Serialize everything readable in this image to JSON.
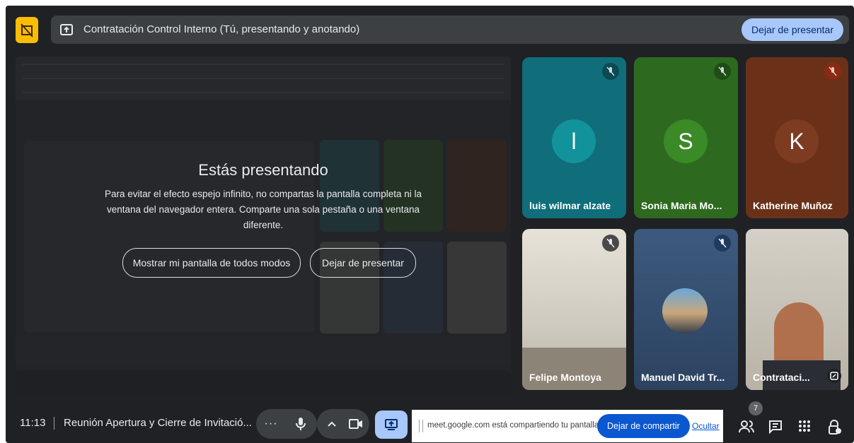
{
  "top_bar": {
    "title": "Contratación Control Interno (Tú, presentando y anotando)",
    "stop_presenting_label": "Dejar de presentar"
  },
  "presenting_overlay": {
    "title": "Estás presentando",
    "message": "Para evitar el efecto espejo infinito, no compartas la pantalla completa ni la ventana del navegador entera. Comparte una sola pestaña o una ventana diferente.",
    "show_anyway_label": "Mostrar mi pantalla de todos modos",
    "stop_presenting_label": "Dejar de presentar"
  },
  "participants": [
    {
      "name": "luis wilmar alzate",
      "initial": "l",
      "muted": true,
      "bg": "#0f6e7a",
      "avatar_bg": "#12939c"
    },
    {
      "name": "Sonia Maria Mo...",
      "initial": "S",
      "muted": true,
      "bg": "#2d6a1f",
      "avatar_bg": "#3a8a28"
    },
    {
      "name": "Katherine Muñoz",
      "initial": "K",
      "muted": true,
      "bg": "#6b3118",
      "avatar_bg": "#7d3b21"
    },
    {
      "name": "Felipe Montoya",
      "initial": "",
      "muted": true,
      "bg": "#d6d2c8",
      "avatar_bg": ""
    },
    {
      "name": "Manuel David Tr...",
      "initial": "",
      "muted": true,
      "bg": "#36506f",
      "avatar_bg": ""
    },
    {
      "name": "Contrataci...",
      "initial": "",
      "muted": false,
      "bg": "#c9c2b6",
      "avatar_bg": ""
    }
  ],
  "bottom_bar": {
    "time": "11:13",
    "meeting_name": "Reunión Apertura y Cierre de Invitació...",
    "sharing_text": "meet.google.com está compartiendo tu pantalla.",
    "stop_sharing_label": "Dejar de compartir",
    "hide_label": "Ocultar",
    "people_count": "7"
  },
  "colors": {
    "background": "#202124",
    "accent": "#a8c7fa",
    "share_button": "#0b57d0",
    "logo": "#fbbc04"
  }
}
